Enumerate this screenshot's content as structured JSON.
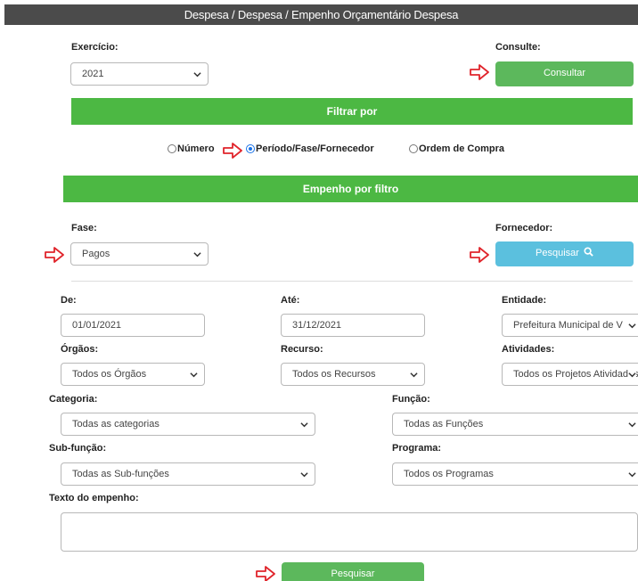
{
  "header": {
    "title": "Despesa / Despesa / Empenho Orçamentário Despesa"
  },
  "exercicio": {
    "label": "Exercício:",
    "value": "2021"
  },
  "consulte": {
    "label": "Consulte:",
    "button": "Consultar"
  },
  "filtrar": {
    "title": "Filtrar por"
  },
  "radios": [
    {
      "label": "Número",
      "checked": false
    },
    {
      "label": "Período/Fase/Fornecedor",
      "checked": true
    },
    {
      "label": "Ordem de Compra",
      "checked": false
    }
  ],
  "empenho": {
    "title": "Empenho por filtro"
  },
  "fase": {
    "label": "Fase:",
    "value": "Pagos"
  },
  "fornecedor": {
    "label": "Fornecedor:",
    "button": "Pesquisar"
  },
  "de": {
    "label": "De:",
    "value": "01/01/2021"
  },
  "ate": {
    "label": "Até:",
    "value": "31/12/2021"
  },
  "entidade": {
    "label": "Entidade:",
    "value": "Prefeitura Municipal de V"
  },
  "orgaos": {
    "label": "Órgãos:",
    "value": "Todos os Órgãos"
  },
  "recurso": {
    "label": "Recurso:",
    "value": "Todos os Recursos"
  },
  "atividades": {
    "label": "Atividades:",
    "value": "Todos os Projetos Atividades"
  },
  "categoria": {
    "label": "Categoria:",
    "value": "Todas as categorias"
  },
  "funcao": {
    "label": "Função:",
    "value": "Todas as Funções"
  },
  "subfuncao": {
    "label": "Sub-função:",
    "value": "Todas as Sub-funções"
  },
  "programa": {
    "label": "Programa:",
    "value": "Todos os Programas"
  },
  "texto": {
    "label": "Texto do empenho:",
    "value": ""
  },
  "submit": {
    "button": "Pesquisar"
  },
  "colors": {
    "green_bar": "#4cb843",
    "green_button": "#5cb85c",
    "blue_button": "#5bc0de",
    "arrow_red": "#e0242b",
    "header_bg": "#4b4b4b"
  },
  "icons": {
    "arrow": "right-arrow-icon",
    "search": "search-icon",
    "chevron": "chevron-down-icon"
  }
}
